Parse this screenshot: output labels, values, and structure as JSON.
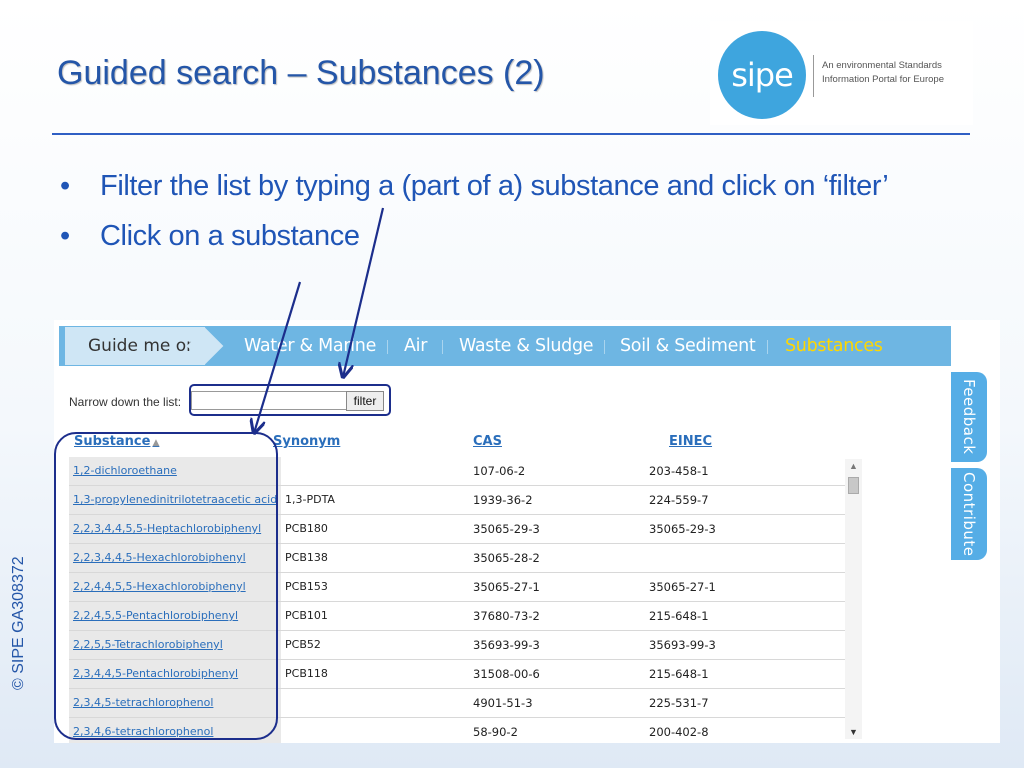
{
  "slide": {
    "title": "Guided search – Substances (2)",
    "bullets": [
      "Filter the list by typing a (part of a) substance and click on ‘filter’",
      "Click on a substance"
    ],
    "copyright": "© SIPE GA308372"
  },
  "logo": {
    "mark": "sipe",
    "tagline": "An environmental Standards Information Portal for Europe"
  },
  "nav": {
    "guide_label": "Guide me on",
    "items": [
      {
        "label": "Water & Marine",
        "active": false
      },
      {
        "label": "Air",
        "active": false
      },
      {
        "label": "Waste & Sludge",
        "active": false
      },
      {
        "label": "Soil & Sediment",
        "active": false
      },
      {
        "label": "Substances",
        "active": true
      }
    ]
  },
  "filter": {
    "label": "Narrow down the list:",
    "input_value": "",
    "button_label": "filter"
  },
  "table": {
    "headers": [
      "Substance",
      "Synonym",
      "CAS",
      "EINEC"
    ],
    "sorted_column": "Substance",
    "rows": [
      {
        "substance": "1,2-dichloroethane",
        "synonym": "",
        "cas": "107-06-2",
        "einec": "203-458-1"
      },
      {
        "substance": "1,3-propylenedinitrilotetraacetic acid",
        "synonym": "1,3-PDTA",
        "cas": "1939-36-2",
        "einec": "224-559-7"
      },
      {
        "substance": "2,2,3,4,4,5,5-Heptachlorobiphenyl",
        "synonym": "PCB180",
        "cas": "35065-29-3",
        "einec": "35065-29-3"
      },
      {
        "substance": "2,2,3,4,4,5-Hexachlorobiphenyl",
        "synonym": "PCB138",
        "cas": "35065-28-2",
        "einec": ""
      },
      {
        "substance": "2,2,4,4,5,5-Hexachlorobiphenyl",
        "synonym": "PCB153",
        "cas": "35065-27-1",
        "einec": "35065-27-1"
      },
      {
        "substance": "2,2,4,5,5-Pentachlorobiphenyl",
        "synonym": "PCB101",
        "cas": "37680-73-2",
        "einec": "215-648-1"
      },
      {
        "substance": "2,2,5,5-Tetrachlorobiphenyl",
        "synonym": "PCB52",
        "cas": "35693-99-3",
        "einec": "35693-99-3"
      },
      {
        "substance": "2,3,4,4,5-Pentachlorobiphenyl",
        "synonym": "PCB118",
        "cas": "31508-00-6",
        "einec": "215-648-1"
      },
      {
        "substance": "2,3,4,5-tetrachlorophenol",
        "synonym": "",
        "cas": "4901-51-3",
        "einec": "225-531-7"
      },
      {
        "substance": "2,3,4,6-tetrachlorophenol",
        "synonym": "",
        "cas": "58-90-2",
        "einec": "200-402-8"
      }
    ]
  },
  "side_tabs": {
    "feedback": "Feedback",
    "contribute": "Contribute"
  },
  "colors": {
    "title": "#2456a8",
    "bullets": "#1f55b6",
    "nav_bar": "#6eb6e3",
    "nav_active": "#ffd700",
    "link": "#2a6ebb",
    "side_tab": "#55ade6",
    "highlight": "#1c2e8c"
  }
}
